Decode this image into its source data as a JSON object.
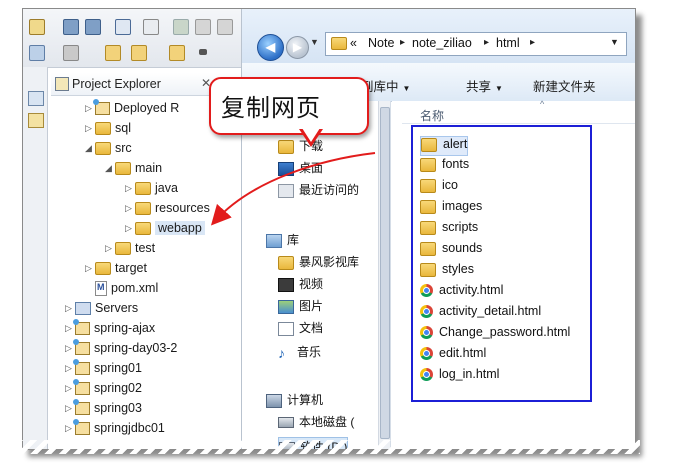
{
  "eclipse": {
    "view_title": "Project Explorer",
    "view_close": "✕",
    "tree": [
      {
        "label": "Deployed R",
        "arrow": "▷",
        "kind": "project"
      },
      {
        "label": "sql",
        "arrow": "▷",
        "kind": "folder"
      },
      {
        "label": "src",
        "arrow": "◢",
        "kind": "folder"
      },
      {
        "label": "main",
        "arrow": "◢",
        "kind": "folder"
      },
      {
        "label": "java",
        "arrow": "▷",
        "kind": "folder"
      },
      {
        "label": "resources",
        "arrow": "▷",
        "kind": "folder"
      },
      {
        "label": "webapp",
        "arrow": "▷",
        "kind": "folder"
      },
      {
        "label": "test",
        "arrow": "▷",
        "kind": "folder"
      },
      {
        "label": "target",
        "arrow": "▷",
        "kind": "folder"
      },
      {
        "label": "pom.xml",
        "arrow": "",
        "kind": "file",
        "glyph": "M"
      },
      {
        "label": "Servers",
        "arrow": "▷",
        "kind": "servers"
      },
      {
        "label": "spring-ajax",
        "arrow": "▷",
        "kind": "project"
      },
      {
        "label": "spring-day03-2",
        "arrow": "▷",
        "kind": "project"
      },
      {
        "label": "spring01",
        "arrow": "▷",
        "kind": "project"
      },
      {
        "label": "spring02",
        "arrow": "▷",
        "kind": "project"
      },
      {
        "label": "spring03",
        "arrow": "▷",
        "kind": "project"
      },
      {
        "label": "springjdbc01",
        "arrow": "▷",
        "kind": "project"
      }
    ]
  },
  "explorer": {
    "breadcrumb": [
      "«",
      "Note",
      "note_ziliao",
      "html"
    ],
    "commands": [
      {
        "label": "包含到库中",
        "dropdown": "▼"
      },
      {
        "label": "共享",
        "dropdown": "▼"
      },
      {
        "label": "新建文件夹",
        "dropdown": ""
      }
    ],
    "column_header": "名称",
    "nav_items": [
      {
        "label": "下载",
        "icon": "folder"
      },
      {
        "label": "桌面",
        "icon": "desktop"
      },
      {
        "label": "最近访问的",
        "icon": "recent"
      },
      {
        "label": "库",
        "icon": "library"
      },
      {
        "label": "暴风影视库",
        "icon": "folder"
      },
      {
        "label": "视频",
        "icon": "video"
      },
      {
        "label": "图片",
        "icon": "picture"
      },
      {
        "label": "文档",
        "icon": "document"
      },
      {
        "label": "音乐",
        "icon": "music"
      },
      {
        "label": "计算机",
        "icon": "computer"
      },
      {
        "label": "本地磁盘 (",
        "icon": "drive"
      },
      {
        "label": "软件 (D:)",
        "icon": "drive"
      }
    ],
    "files": [
      {
        "name": "alert",
        "type": "folder"
      },
      {
        "name": "fonts",
        "type": "folder"
      },
      {
        "name": "ico",
        "type": "folder"
      },
      {
        "name": "images",
        "type": "folder"
      },
      {
        "name": "scripts",
        "type": "folder"
      },
      {
        "name": "sounds",
        "type": "folder"
      },
      {
        "name": "styles",
        "type": "folder"
      },
      {
        "name": "activity.html",
        "type": "html"
      },
      {
        "name": "activity_detail.html",
        "type": "html"
      },
      {
        "name": "Change_password.html",
        "type": "html"
      },
      {
        "name": "edit.html",
        "type": "html"
      },
      {
        "name": "log_in.html",
        "type": "html"
      }
    ]
  },
  "callout": {
    "text": "复制网页"
  },
  "colors": {
    "callout_border": "#e21c1c",
    "highlight_box": "#1c1fd6",
    "arrow": "#e21c1c"
  }
}
